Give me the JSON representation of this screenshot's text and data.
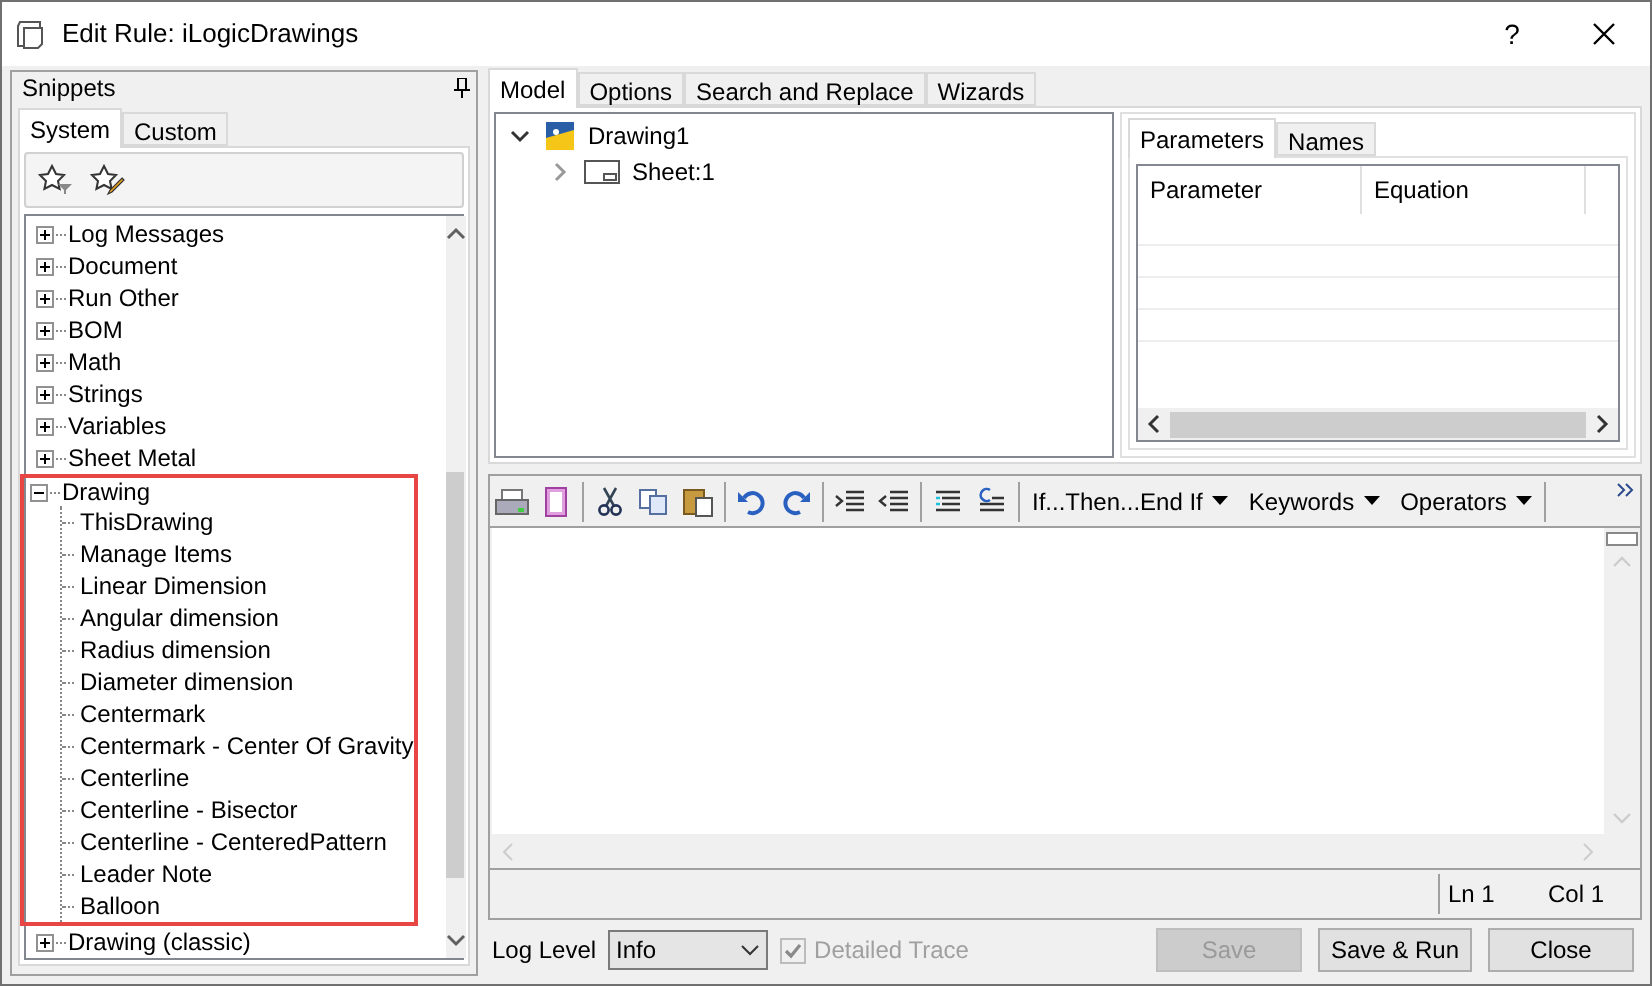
{
  "window": {
    "title": "Edit Rule: iLogicDrawings",
    "help": "?"
  },
  "snippets": {
    "title": "Snippets",
    "tabs": [
      {
        "label": "System",
        "selected": true
      },
      {
        "label": "Custom",
        "selected": false
      }
    ],
    "tree": [
      {
        "label": "Log Messages",
        "expanded": false,
        "highlighted": false
      },
      {
        "label": "Document",
        "expanded": false,
        "highlighted": false
      },
      {
        "label": "Run Other",
        "expanded": false,
        "highlighted": false
      },
      {
        "label": "BOM",
        "expanded": false,
        "highlighted": false
      },
      {
        "label": "Math",
        "expanded": false,
        "highlighted": false
      },
      {
        "label": "Strings",
        "expanded": false,
        "highlighted": false
      },
      {
        "label": "Variables",
        "expanded": false,
        "highlighted": false
      },
      {
        "label": "Sheet Metal",
        "expanded": false,
        "highlighted": false
      },
      {
        "label": "Drawing",
        "expanded": true,
        "highlighted": true,
        "children": [
          {
            "label": "ThisDrawing"
          },
          {
            "label": "Manage Items"
          },
          {
            "label": "Linear Dimension"
          },
          {
            "label": "Angular dimension"
          },
          {
            "label": "Radius dimension"
          },
          {
            "label": "Diameter dimension"
          },
          {
            "label": "Centermark"
          },
          {
            "label": "Centermark - Center Of Gravity"
          },
          {
            "label": "Centerline"
          },
          {
            "label": "Centerline - Bisector"
          },
          {
            "label": "Centerline - CenteredPattern"
          },
          {
            "label": "Leader Note"
          },
          {
            "label": "Balloon"
          }
        ]
      },
      {
        "label": "Drawing (classic)",
        "expanded": false,
        "highlighted": false
      }
    ]
  },
  "main_tabs": [
    {
      "label": "Model",
      "selected": true
    },
    {
      "label": "Options",
      "selected": false
    },
    {
      "label": "Search and Replace",
      "selected": false
    },
    {
      "label": "Wizards",
      "selected": false
    }
  ],
  "model_tree": [
    {
      "label": "Drawing1",
      "expanded": true,
      "children": [
        {
          "label": "Sheet:1",
          "expanded": false
        }
      ]
    }
  ],
  "parameters": {
    "tabs": [
      {
        "label": "Parameters",
        "selected": true
      },
      {
        "label": "Names",
        "selected": false
      }
    ],
    "columns": [
      "Parameter",
      "Equation"
    ]
  },
  "editor": {
    "menus": [
      "If...Then...End If",
      "Keywords",
      "Operators"
    ],
    "line": "Ln 1",
    "column": "Col 1"
  },
  "footer": {
    "log_level_label": "Log Level",
    "log_level": "Info",
    "detailed_trace": {
      "label": "Detailed Trace",
      "checked": true,
      "disabled": true
    },
    "buttons": [
      {
        "label": "Save",
        "disabled": true
      },
      {
        "label": "Save & Run",
        "disabled": false
      },
      {
        "label": "Close",
        "disabled": false
      }
    ]
  }
}
